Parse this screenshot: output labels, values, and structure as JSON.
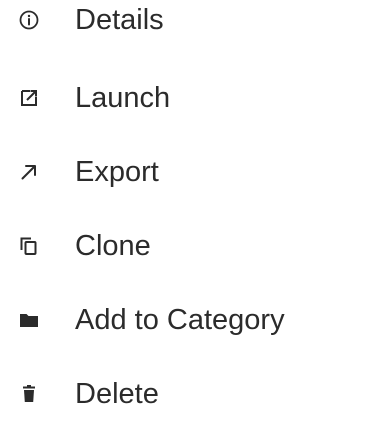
{
  "menu": {
    "items": [
      {
        "label": "Details",
        "icon": "info-circle-icon"
      },
      {
        "label": "Launch",
        "icon": "external-link-icon"
      },
      {
        "label": "Export",
        "icon": "arrow-up-right-icon"
      },
      {
        "label": "Clone",
        "icon": "copy-icon"
      },
      {
        "label": "Add to Category",
        "icon": "folder-icon"
      },
      {
        "label": "Delete",
        "icon": "trash-icon"
      }
    ]
  },
  "colors": {
    "text": "#2b2b2b",
    "icon": "#2b2b2b",
    "background": "#ffffff"
  }
}
